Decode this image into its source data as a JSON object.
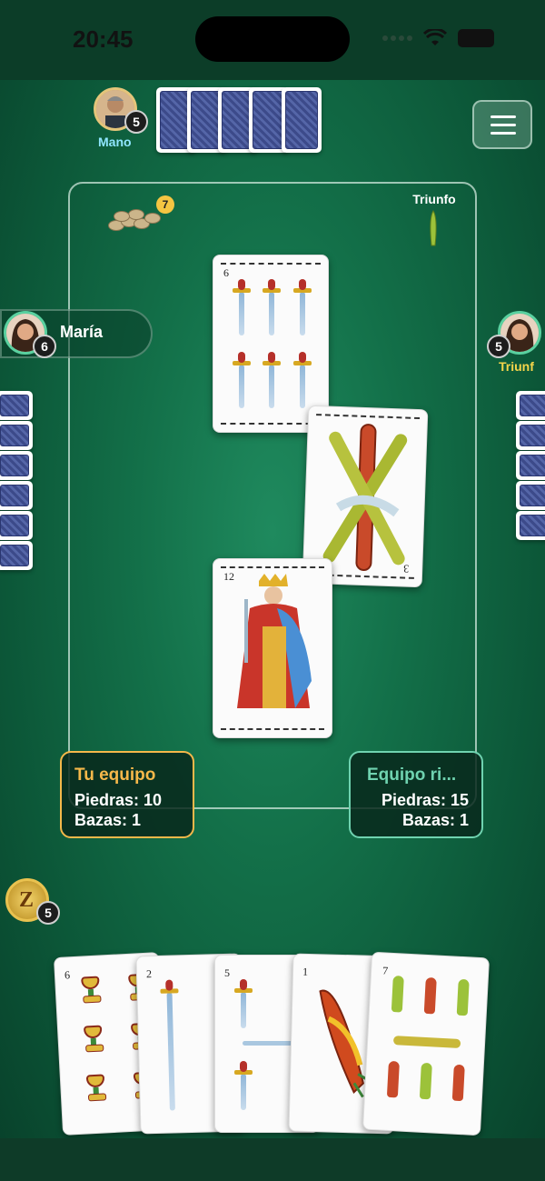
{
  "status_bar": {
    "time": "20:45"
  },
  "top_player": {
    "badge": "5",
    "role": "Mano"
  },
  "left_player": {
    "name": "María",
    "badge": "6"
  },
  "right_player": {
    "badge": "5",
    "role": "Triunf"
  },
  "table": {
    "stones_count": "7",
    "triunfo_label": "Triunfo",
    "played_cards": [
      {
        "number": "6",
        "suit": "espadas"
      },
      {
        "number": "3",
        "suit": "bastos"
      },
      {
        "number": "12",
        "suit": "espadas"
      }
    ]
  },
  "scores": {
    "mine": {
      "title": "Tu equipo",
      "piedras": "Piedras: 10",
      "bazas": "Bazas: 1"
    },
    "rival": {
      "title": "Equipo ri...",
      "piedras": "Piedras: 15",
      "bazas": "Bazas: 1"
    }
  },
  "me": {
    "badge": "5"
  },
  "hand": [
    {
      "number": "6",
      "suit": "copas"
    },
    {
      "number": "2",
      "suit": "espadas"
    },
    {
      "number": "5",
      "suit": "espadas"
    },
    {
      "number": "1",
      "suit": "bastos"
    },
    {
      "number": "7",
      "suit": "bastos"
    }
  ],
  "colors": {
    "table_green": "#137049",
    "mine_accent": "#f5b84a",
    "rival_accent": "#6fd3b0"
  }
}
